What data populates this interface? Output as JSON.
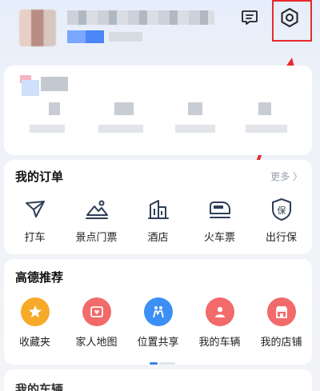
{
  "header": {
    "avatar_icon": "avatar",
    "message_icon": "message-icon",
    "settings_icon": "gear-icon",
    "highlight_color": "#e82a2a"
  },
  "orders": {
    "title": "我的订单",
    "more": "更多 〉",
    "items": [
      {
        "label": "打车",
        "icon": "taxi-icon"
      },
      {
        "label": "景点门票",
        "icon": "scenic-ticket-icon"
      },
      {
        "label": "酒店",
        "icon": "hotel-icon"
      },
      {
        "label": "火车票",
        "icon": "train-icon"
      },
      {
        "label": "出行保",
        "icon": "insurance-icon"
      }
    ]
  },
  "recommend": {
    "title": "高德推荐",
    "items": [
      {
        "label": "收藏夹",
        "icon": "star-icon",
        "color": "#f7a928"
      },
      {
        "label": "家人地图",
        "icon": "family-map-icon",
        "color": "#f26a6a"
      },
      {
        "label": "位置共享",
        "icon": "location-share-icon",
        "color": "#3c8ff5"
      },
      {
        "label": "我的车辆",
        "icon": "car-icon",
        "color": "#f26a6a"
      },
      {
        "label": "我的店铺",
        "icon": "shop-icon",
        "color": "#f26a6a"
      }
    ]
  },
  "bottom": {
    "title": "我的车辆"
  },
  "colors": {
    "accent": "#3a7ff6",
    "icon_stroke": "#2f3e57"
  }
}
